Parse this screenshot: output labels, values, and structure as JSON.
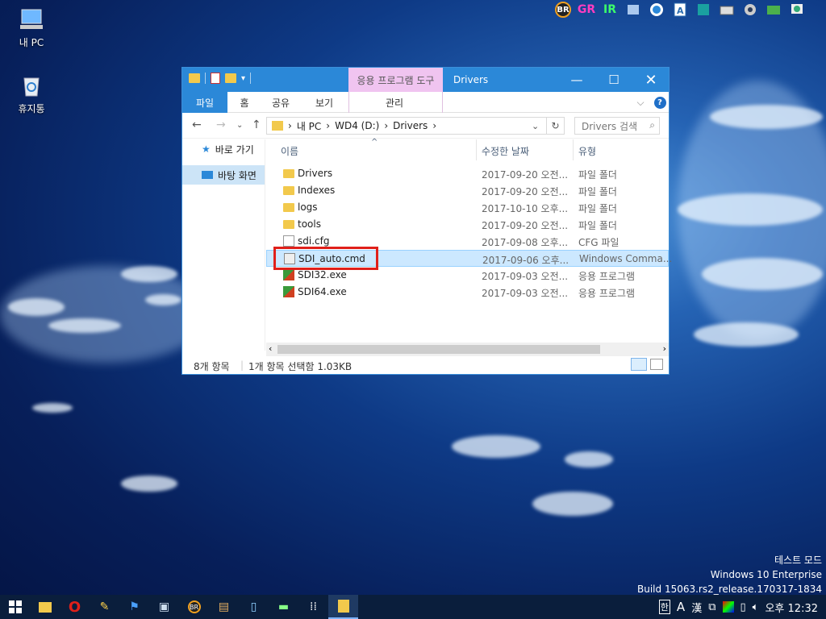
{
  "desktop": {
    "icons": [
      {
        "label": "내 PC"
      },
      {
        "label": "휴지통"
      }
    ]
  },
  "tray_top": [
    "BR",
    "GR",
    "IR"
  ],
  "window": {
    "title": "Drivers",
    "context_tab": "응용 프로그램 도구",
    "ribbon_tabs": [
      "파일",
      "홈",
      "공유",
      "보기",
      "관리"
    ],
    "address": [
      "내 PC",
      "WD4 (D:)",
      "Drivers"
    ],
    "search_placeholder": "Drivers 검색",
    "nav": [
      {
        "label": "바로 가기"
      },
      {
        "label": "바탕 화면"
      }
    ],
    "columns": [
      "이름",
      "수정한 날짜",
      "유형"
    ],
    "files": [
      {
        "name": "Drivers",
        "date": "2017-09-20 오전...",
        "type": "파일 폴더",
        "icon": "folder"
      },
      {
        "name": "Indexes",
        "date": "2017-09-20 오전...",
        "type": "파일 폴더",
        "icon": "folder"
      },
      {
        "name": "logs",
        "date": "2017-10-10 오후...",
        "type": "파일 폴더",
        "icon": "folder"
      },
      {
        "name": "tools",
        "date": "2017-09-20 오전...",
        "type": "파일 폴더",
        "icon": "folder"
      },
      {
        "name": "sdi.cfg",
        "date": "2017-09-08 오후...",
        "type": "CFG 파일",
        "icon": "cfg"
      },
      {
        "name": "SDI_auto.cmd",
        "date": "2017-09-06 오후...",
        "type": "Windows Comma...",
        "icon": "cmd"
      },
      {
        "name": "SDI32.exe",
        "date": "2017-09-03 오전...",
        "type": "응용 프로그램",
        "icon": "exe"
      },
      {
        "name": "SDI64.exe",
        "date": "2017-09-03 오전...",
        "type": "응용 프로그램",
        "icon": "exe"
      }
    ],
    "status_count": "8개 항목",
    "status_selected": "1개 항목 선택함 1.03KB"
  },
  "watermark": {
    "line1": "테스트 모드",
    "line2": "Windows 10 Enterprise",
    "line3": "Build 15063.rs2_release.170317-1834"
  },
  "taskbar": {
    "tray_ime1": "한",
    "tray_ime2": "A",
    "tray_ime3": "漢",
    "clock": "오후 12:32"
  },
  "colors": {
    "accent": "#2b88d8",
    "selection": "#cce8ff",
    "highlight_box": "#e0201a"
  }
}
